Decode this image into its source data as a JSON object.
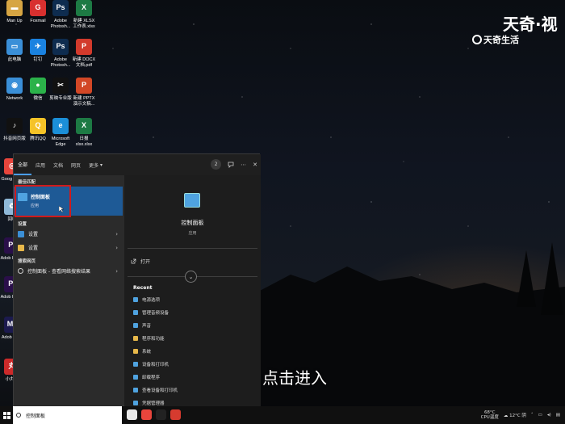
{
  "desktop_icons": [
    {
      "label": "Man Up",
      "icon": "folder-icon",
      "color": "#d6a543"
    },
    {
      "label": "Foxmail",
      "icon": "foxmail-icon",
      "color": "#d8302f"
    },
    {
      "label": "Adobe Photosh...",
      "icon": "photoshop-icon",
      "color": "#0e2c4f"
    },
    {
      "label": "新建 XLSX 工作表.xlsx",
      "icon": "xlsx-file-icon",
      "color": "#1d7a44"
    },
    {
      "label": "此电脑",
      "icon": "computer-icon",
      "color": "#3a8fd8"
    },
    {
      "label": "钉钉",
      "icon": "dingtalk-icon",
      "color": "#1a82e0"
    },
    {
      "label": "Adobe Photosh...",
      "icon": "photoshop-icon",
      "color": "#0e2c4f"
    },
    {
      "label": "新建 DOCX 文档.pdf",
      "icon": "pdf-file-icon",
      "color": "#d23a2c"
    },
    {
      "label": "Network",
      "icon": "network-icon",
      "color": "#3a8fd8"
    },
    {
      "label": "微信",
      "icon": "wechat-icon",
      "color": "#2bb24a"
    },
    {
      "label": "剪映专业版",
      "icon": "capcut-icon",
      "color": "#111111"
    },
    {
      "label": "新建 PPTX 演示文稿...",
      "icon": "pptx-file-icon",
      "color": "#d24726"
    },
    {
      "label": "抖音网页版",
      "icon": "douyin-icon",
      "color": "#111111"
    },
    {
      "label": "腾讯QQ",
      "icon": "qq-icon",
      "color": "#f5c327"
    },
    {
      "label": "Microsoft Edge",
      "icon": "edge-icon",
      "color": "#1b8fd8"
    },
    {
      "label": "日报xlsx.xlsx",
      "icon": "xlsx-file-icon",
      "color": "#1d7a44"
    },
    {
      "label": "Goog Chro",
      "icon": "chrome-icon",
      "color": "#e8453c"
    },
    {
      "label": "回收",
      "icon": "recycle-bin-icon",
      "color": "#8fb8d8"
    },
    {
      "label": "Adob Premi",
      "icon": "premiere-icon",
      "color": "#2a0f4a"
    },
    {
      "label": "Adob Premi",
      "icon": "premiere-icon",
      "color": "#2a0f4a"
    },
    {
      "label": "Adob Medi",
      "icon": "media-encoder-icon",
      "color": "#1c1a4e"
    },
    {
      "label": "小丸工",
      "icon": "toolbox-icon",
      "color": "#cc2a2a"
    }
  ],
  "watermark": {
    "main": "天奇·视",
    "sub": "天奇生活"
  },
  "start_menu": {
    "tabs": [
      "全部",
      "应用",
      "文档",
      "网页",
      "更多"
    ],
    "more_arrow": "▾",
    "badge": "2",
    "best_match_label": "最佳匹配",
    "best_match": {
      "title": "控制面板",
      "subtitle": "应用"
    },
    "settings_label": "设置",
    "settings_items": [
      {
        "label": "设置",
        "color": "#3b8fd6"
      },
      {
        "label": "设置",
        "color": "#e8b84a"
      }
    ],
    "web_label": "搜索网页",
    "web_item": {
      "label": "控制面板 - 查看网络搜索结果"
    },
    "preview": {
      "title": "控制面板",
      "subtitle": "应用",
      "open": "打开"
    },
    "recent_label": "Recent",
    "recent_items": [
      {
        "label": "电源选项",
        "color": "#4fa3e0"
      },
      {
        "label": "管理音频设备",
        "color": "#4fa3e0"
      },
      {
        "label": "声音",
        "color": "#4fa3e0"
      },
      {
        "label": "程序和功能",
        "color": "#e8b84a"
      },
      {
        "label": "系统",
        "color": "#e8b84a"
      },
      {
        "label": "设备和打印机",
        "color": "#4fa3e0"
      },
      {
        "label": "卸载程序",
        "color": "#4fa3e0"
      },
      {
        "label": "查看设备和打印机",
        "color": "#4fa3e0"
      },
      {
        "label": "凭据管理器",
        "color": "#4fa3e0"
      }
    ]
  },
  "caption": "点击进入",
  "taskbar": {
    "search_text": "控制面板",
    "apps": [
      {
        "name": "baidu-netdisk-icon",
        "color": "#e9e9e9"
      },
      {
        "name": "chrome-icon",
        "color": "#e8453c"
      },
      {
        "name": "capcut-icon",
        "color": "#222222"
      },
      {
        "name": "wps-icon",
        "color": "#d63b2f"
      }
    ],
    "temp_value": "68°C",
    "temp_label": "CPU温度",
    "weather": "12°C 阴"
  }
}
